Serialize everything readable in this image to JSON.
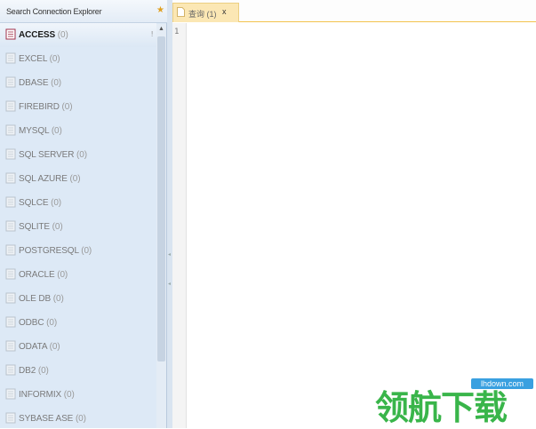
{
  "explorer": {
    "title": "Search Connection Explorer",
    "items": [
      {
        "name": "ACCESS",
        "count": "(0)",
        "selected": true,
        "icon": "access-icon"
      },
      {
        "name": "EXCEL",
        "count": "(0)",
        "icon": "excel-icon"
      },
      {
        "name": "DBASE",
        "count": "(0)",
        "icon": "dbase-icon"
      },
      {
        "name": "FIREBIRD",
        "count": "(0)",
        "icon": "firebird-icon"
      },
      {
        "name": "MYSQL",
        "count": "(0)",
        "icon": "mysql-icon"
      },
      {
        "name": "SQL SERVER",
        "count": "(0)",
        "icon": "sql-server-icon"
      },
      {
        "name": "SQL AZURE",
        "count": "(0)",
        "icon": "sql-azure-icon"
      },
      {
        "name": "SQLCE",
        "count": "(0)",
        "icon": "sqlce-icon"
      },
      {
        "name": "SQLITE",
        "count": "(0)",
        "icon": "sqlite-icon"
      },
      {
        "name": "POSTGRESQL",
        "count": "(0)",
        "icon": "postgresql-icon"
      },
      {
        "name": "ORACLE",
        "count": "(0)",
        "icon": "oracle-icon"
      },
      {
        "name": "OLE DB",
        "count": "(0)",
        "icon": "ole-db-icon"
      },
      {
        "name": "ODBC",
        "count": "(0)",
        "icon": "odbc-icon"
      },
      {
        "name": "ODATA",
        "count": "(0)",
        "icon": "odata-icon"
      },
      {
        "name": "DB2",
        "count": "(0)",
        "icon": "db2-icon"
      },
      {
        "name": "INFORMIX",
        "count": "(0)",
        "icon": "informix-icon"
      },
      {
        "name": "SYBASE ASE",
        "count": "(0)",
        "icon": "sybase-ase-icon"
      }
    ],
    "selected_marker": "!"
  },
  "tabs": [
    {
      "label": "查询 (1)",
      "close": "x"
    }
  ],
  "editor": {
    "line_numbers": [
      "1"
    ]
  },
  "watermark": {
    "site": "lhdown.com",
    "text": "领航下载"
  },
  "colors": {
    "accent": "#f3c34e",
    "panel": "#dde9f6",
    "watermark_green": "#39b54a",
    "watermark_blue": "#39a0e0"
  }
}
